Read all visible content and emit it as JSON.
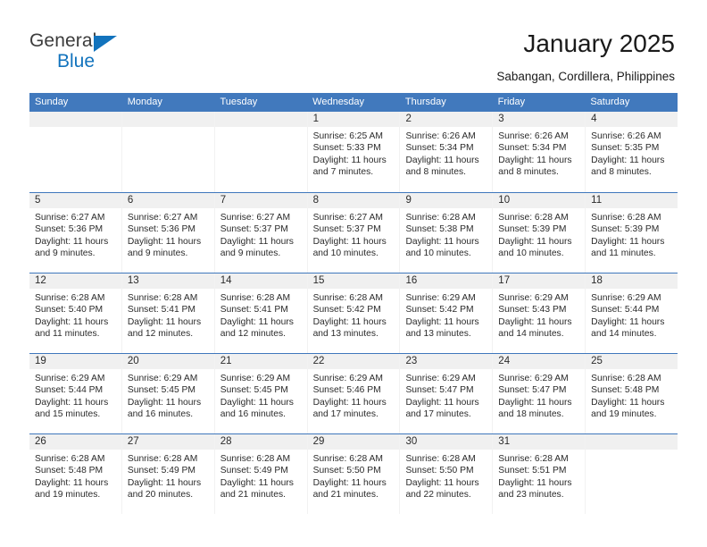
{
  "brand": {
    "line1": "General",
    "line2": "Blue",
    "triangle_icon": "triangle-icon",
    "color_dark": "#3c3c3c",
    "color_blue": "#1273bd"
  },
  "header": {
    "title": "January 2025",
    "subtitle": "Sabangan, Cordillera, Philippines"
  },
  "theme": {
    "header_blue": "#4179bd",
    "row_rule_blue": "#3f77bc",
    "daynum_strip": "#f0f0f0"
  },
  "calendar": {
    "weekday_headers": [
      "Sunday",
      "Monday",
      "Tuesday",
      "Wednesday",
      "Thursday",
      "Friday",
      "Saturday"
    ],
    "weeks": [
      [
        {
          "day": "",
          "empty": true,
          "lines": []
        },
        {
          "day": "",
          "empty": true,
          "lines": []
        },
        {
          "day": "",
          "empty": true,
          "lines": []
        },
        {
          "day": "1",
          "empty": false,
          "lines": [
            "Sunrise: 6:25 AM",
            "Sunset: 5:33 PM",
            "Daylight: 11 hours",
            "and 7 minutes."
          ]
        },
        {
          "day": "2",
          "empty": false,
          "lines": [
            "Sunrise: 6:26 AM",
            "Sunset: 5:34 PM",
            "Daylight: 11 hours",
            "and 8 minutes."
          ]
        },
        {
          "day": "3",
          "empty": false,
          "lines": [
            "Sunrise: 6:26 AM",
            "Sunset: 5:34 PM",
            "Daylight: 11 hours",
            "and 8 minutes."
          ]
        },
        {
          "day": "4",
          "empty": false,
          "lines": [
            "Sunrise: 6:26 AM",
            "Sunset: 5:35 PM",
            "Daylight: 11 hours",
            "and 8 minutes."
          ]
        }
      ],
      [
        {
          "day": "5",
          "empty": false,
          "lines": [
            "Sunrise: 6:27 AM",
            "Sunset: 5:36 PM",
            "Daylight: 11 hours",
            "and 9 minutes."
          ]
        },
        {
          "day": "6",
          "empty": false,
          "lines": [
            "Sunrise: 6:27 AM",
            "Sunset: 5:36 PM",
            "Daylight: 11 hours",
            "and 9 minutes."
          ]
        },
        {
          "day": "7",
          "empty": false,
          "lines": [
            "Sunrise: 6:27 AM",
            "Sunset: 5:37 PM",
            "Daylight: 11 hours",
            "and 9 minutes."
          ]
        },
        {
          "day": "8",
          "empty": false,
          "lines": [
            "Sunrise: 6:27 AM",
            "Sunset: 5:37 PM",
            "Daylight: 11 hours",
            "and 10 minutes."
          ]
        },
        {
          "day": "9",
          "empty": false,
          "lines": [
            "Sunrise: 6:28 AM",
            "Sunset: 5:38 PM",
            "Daylight: 11 hours",
            "and 10 minutes."
          ]
        },
        {
          "day": "10",
          "empty": false,
          "lines": [
            "Sunrise: 6:28 AM",
            "Sunset: 5:39 PM",
            "Daylight: 11 hours",
            "and 10 minutes."
          ]
        },
        {
          "day": "11",
          "empty": false,
          "lines": [
            "Sunrise: 6:28 AM",
            "Sunset: 5:39 PM",
            "Daylight: 11 hours",
            "and 11 minutes."
          ]
        }
      ],
      [
        {
          "day": "12",
          "empty": false,
          "lines": [
            "Sunrise: 6:28 AM",
            "Sunset: 5:40 PM",
            "Daylight: 11 hours",
            "and 11 minutes."
          ]
        },
        {
          "day": "13",
          "empty": false,
          "lines": [
            "Sunrise: 6:28 AM",
            "Sunset: 5:41 PM",
            "Daylight: 11 hours",
            "and 12 minutes."
          ]
        },
        {
          "day": "14",
          "empty": false,
          "lines": [
            "Sunrise: 6:28 AM",
            "Sunset: 5:41 PM",
            "Daylight: 11 hours",
            "and 12 minutes."
          ]
        },
        {
          "day": "15",
          "empty": false,
          "lines": [
            "Sunrise: 6:28 AM",
            "Sunset: 5:42 PM",
            "Daylight: 11 hours",
            "and 13 minutes."
          ]
        },
        {
          "day": "16",
          "empty": false,
          "lines": [
            "Sunrise: 6:29 AM",
            "Sunset: 5:42 PM",
            "Daylight: 11 hours",
            "and 13 minutes."
          ]
        },
        {
          "day": "17",
          "empty": false,
          "lines": [
            "Sunrise: 6:29 AM",
            "Sunset: 5:43 PM",
            "Daylight: 11 hours",
            "and 14 minutes."
          ]
        },
        {
          "day": "18",
          "empty": false,
          "lines": [
            "Sunrise: 6:29 AM",
            "Sunset: 5:44 PM",
            "Daylight: 11 hours",
            "and 14 minutes."
          ]
        }
      ],
      [
        {
          "day": "19",
          "empty": false,
          "lines": [
            "Sunrise: 6:29 AM",
            "Sunset: 5:44 PM",
            "Daylight: 11 hours",
            "and 15 minutes."
          ]
        },
        {
          "day": "20",
          "empty": false,
          "lines": [
            "Sunrise: 6:29 AM",
            "Sunset: 5:45 PM",
            "Daylight: 11 hours",
            "and 16 minutes."
          ]
        },
        {
          "day": "21",
          "empty": false,
          "lines": [
            "Sunrise: 6:29 AM",
            "Sunset: 5:45 PM",
            "Daylight: 11 hours",
            "and 16 minutes."
          ]
        },
        {
          "day": "22",
          "empty": false,
          "lines": [
            "Sunrise: 6:29 AM",
            "Sunset: 5:46 PM",
            "Daylight: 11 hours",
            "and 17 minutes."
          ]
        },
        {
          "day": "23",
          "empty": false,
          "lines": [
            "Sunrise: 6:29 AM",
            "Sunset: 5:47 PM",
            "Daylight: 11 hours",
            "and 17 minutes."
          ]
        },
        {
          "day": "24",
          "empty": false,
          "lines": [
            "Sunrise: 6:29 AM",
            "Sunset: 5:47 PM",
            "Daylight: 11 hours",
            "and 18 minutes."
          ]
        },
        {
          "day": "25",
          "empty": false,
          "lines": [
            "Sunrise: 6:28 AM",
            "Sunset: 5:48 PM",
            "Daylight: 11 hours",
            "and 19 minutes."
          ]
        }
      ],
      [
        {
          "day": "26",
          "empty": false,
          "lines": [
            "Sunrise: 6:28 AM",
            "Sunset: 5:48 PM",
            "Daylight: 11 hours",
            "and 19 minutes."
          ]
        },
        {
          "day": "27",
          "empty": false,
          "lines": [
            "Sunrise: 6:28 AM",
            "Sunset: 5:49 PM",
            "Daylight: 11 hours",
            "and 20 minutes."
          ]
        },
        {
          "day": "28",
          "empty": false,
          "lines": [
            "Sunrise: 6:28 AM",
            "Sunset: 5:49 PM",
            "Daylight: 11 hours",
            "and 21 minutes."
          ]
        },
        {
          "day": "29",
          "empty": false,
          "lines": [
            "Sunrise: 6:28 AM",
            "Sunset: 5:50 PM",
            "Daylight: 11 hours",
            "and 21 minutes."
          ]
        },
        {
          "day": "30",
          "empty": false,
          "lines": [
            "Sunrise: 6:28 AM",
            "Sunset: 5:50 PM",
            "Daylight: 11 hours",
            "and 22 minutes."
          ]
        },
        {
          "day": "31",
          "empty": false,
          "lines": [
            "Sunrise: 6:28 AM",
            "Sunset: 5:51 PM",
            "Daylight: 11 hours",
            "and 23 minutes."
          ]
        },
        {
          "day": "",
          "empty": true,
          "lines": []
        }
      ]
    ]
  }
}
